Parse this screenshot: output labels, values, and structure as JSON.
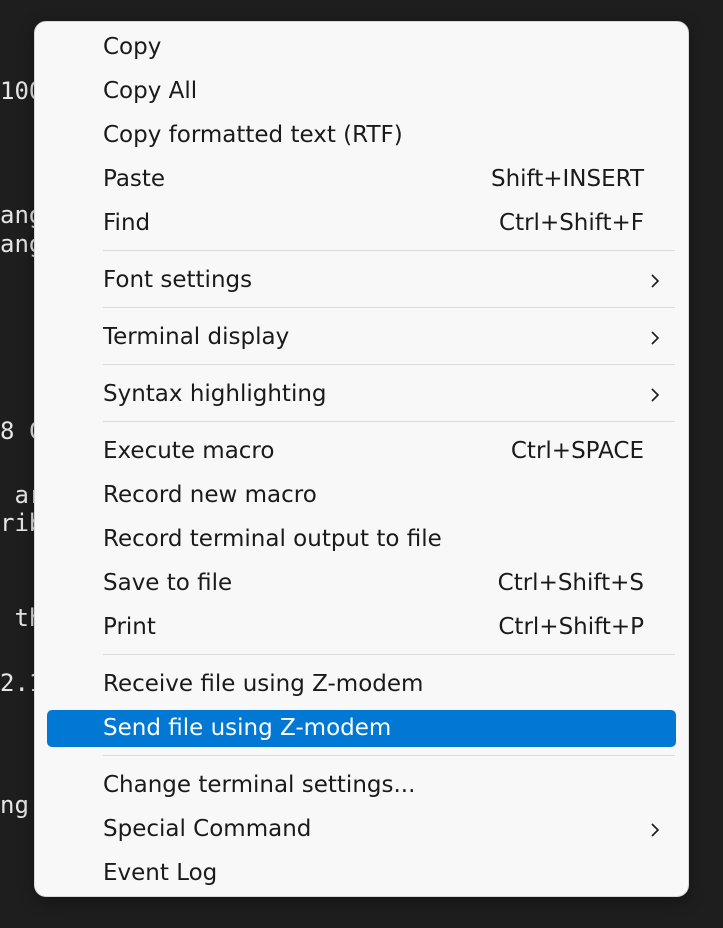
{
  "terminal": {
    "background": "#1e1e1e",
    "lines": [
      "100",
      "ang",
      "ang",
      "8 C",
      " ar",
      "rib",
      " th",
      "2.1",
      "ng "
    ]
  },
  "menu": {
    "highlight_color": "#0078d4",
    "items": [
      {
        "label": "Copy",
        "shortcut": ""
      },
      {
        "label": "Copy All",
        "shortcut": ""
      },
      {
        "label": "Copy formatted text (RTF)",
        "shortcut": ""
      },
      {
        "label": "Paste",
        "shortcut": "Shift+INSERT"
      },
      {
        "label": "Find",
        "shortcut": "Ctrl+Shift+F"
      },
      {
        "label": "Font settings",
        "shortcut": "",
        "submenu_icon": "chevron-right-icon"
      },
      {
        "label": "Terminal display",
        "shortcut": "",
        "submenu_icon": "chevron-right-icon"
      },
      {
        "label": "Syntax highlighting",
        "shortcut": "",
        "submenu_icon": "chevron-right-icon"
      },
      {
        "label": "Execute macro",
        "shortcut": "Ctrl+SPACE"
      },
      {
        "label": "Record new macro",
        "shortcut": ""
      },
      {
        "label": "Record terminal output to file",
        "shortcut": ""
      },
      {
        "label": "Save to file",
        "shortcut": "Ctrl+Shift+S"
      },
      {
        "label": "Print",
        "shortcut": "Ctrl+Shift+P"
      },
      {
        "label": "Receive file using Z-modem",
        "shortcut": ""
      },
      {
        "label": "Send file using Z-modem",
        "shortcut": "",
        "highlighted": true
      },
      {
        "label": "Change terminal settings...",
        "shortcut": ""
      },
      {
        "label": "Special Command",
        "shortcut": "",
        "submenu_icon": "chevron-right-icon"
      },
      {
        "label": "Event Log",
        "shortcut": ""
      }
    ]
  }
}
